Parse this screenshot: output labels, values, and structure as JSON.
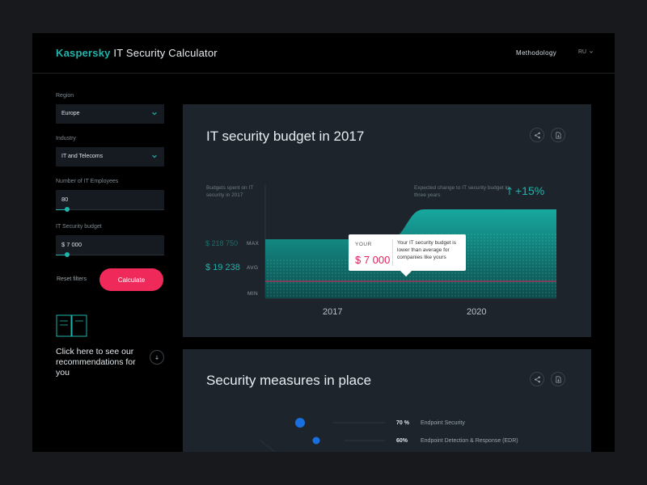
{
  "header": {
    "brand": "Kaspersky",
    "title": "IT Security Calculator",
    "methodology": "Methodology",
    "lang": "RU"
  },
  "sidebar": {
    "region": {
      "label": "Region",
      "value": "Europe"
    },
    "industry": {
      "label": "Industry",
      "value": "IT and Telecoms"
    },
    "employees": {
      "label": "Number of IT Employees",
      "value": "80"
    },
    "budget": {
      "label": "IT Security budget",
      "value": "$ 7 000"
    },
    "reset_label": "Reset filters",
    "calculate_label": "Calculate",
    "recommendations": "Click here to see our recommendations for you"
  },
  "budget_card": {
    "title": "IT security budget in 2017",
    "left_note": "Budgets spent on IT security in 2017",
    "right_note": "Expected change to IT security budget in three years",
    "change": "+15%",
    "max_value": "$ 218 750",
    "avg_value": "$ 19 238",
    "max_label": "MAX",
    "avg_label": "AVG",
    "min_label": "MIN",
    "year_start": "2017",
    "year_end": "2020",
    "tooltip": {
      "label": "YOUR",
      "amount": "$ 7 000",
      "message": "Your IT security budget is lower than average for companies like yours"
    }
  },
  "measures_card": {
    "title": "Security measures in place",
    "items": [
      {
        "pct": "70 %",
        "name": "Endpoint Security"
      },
      {
        "pct": "60%",
        "name": "Endpoint Detection & Response (EDR)"
      }
    ]
  },
  "colors": {
    "accent": "#1fb5ad",
    "cta": "#f0295b",
    "card": "#1d242b",
    "blue_dot": "#1a6fe0"
  },
  "icons": [
    "chevron-down-icon",
    "share-icon",
    "download-icon",
    "book-icon",
    "arrow-down-icon",
    "arrow-up-icon"
  ]
}
